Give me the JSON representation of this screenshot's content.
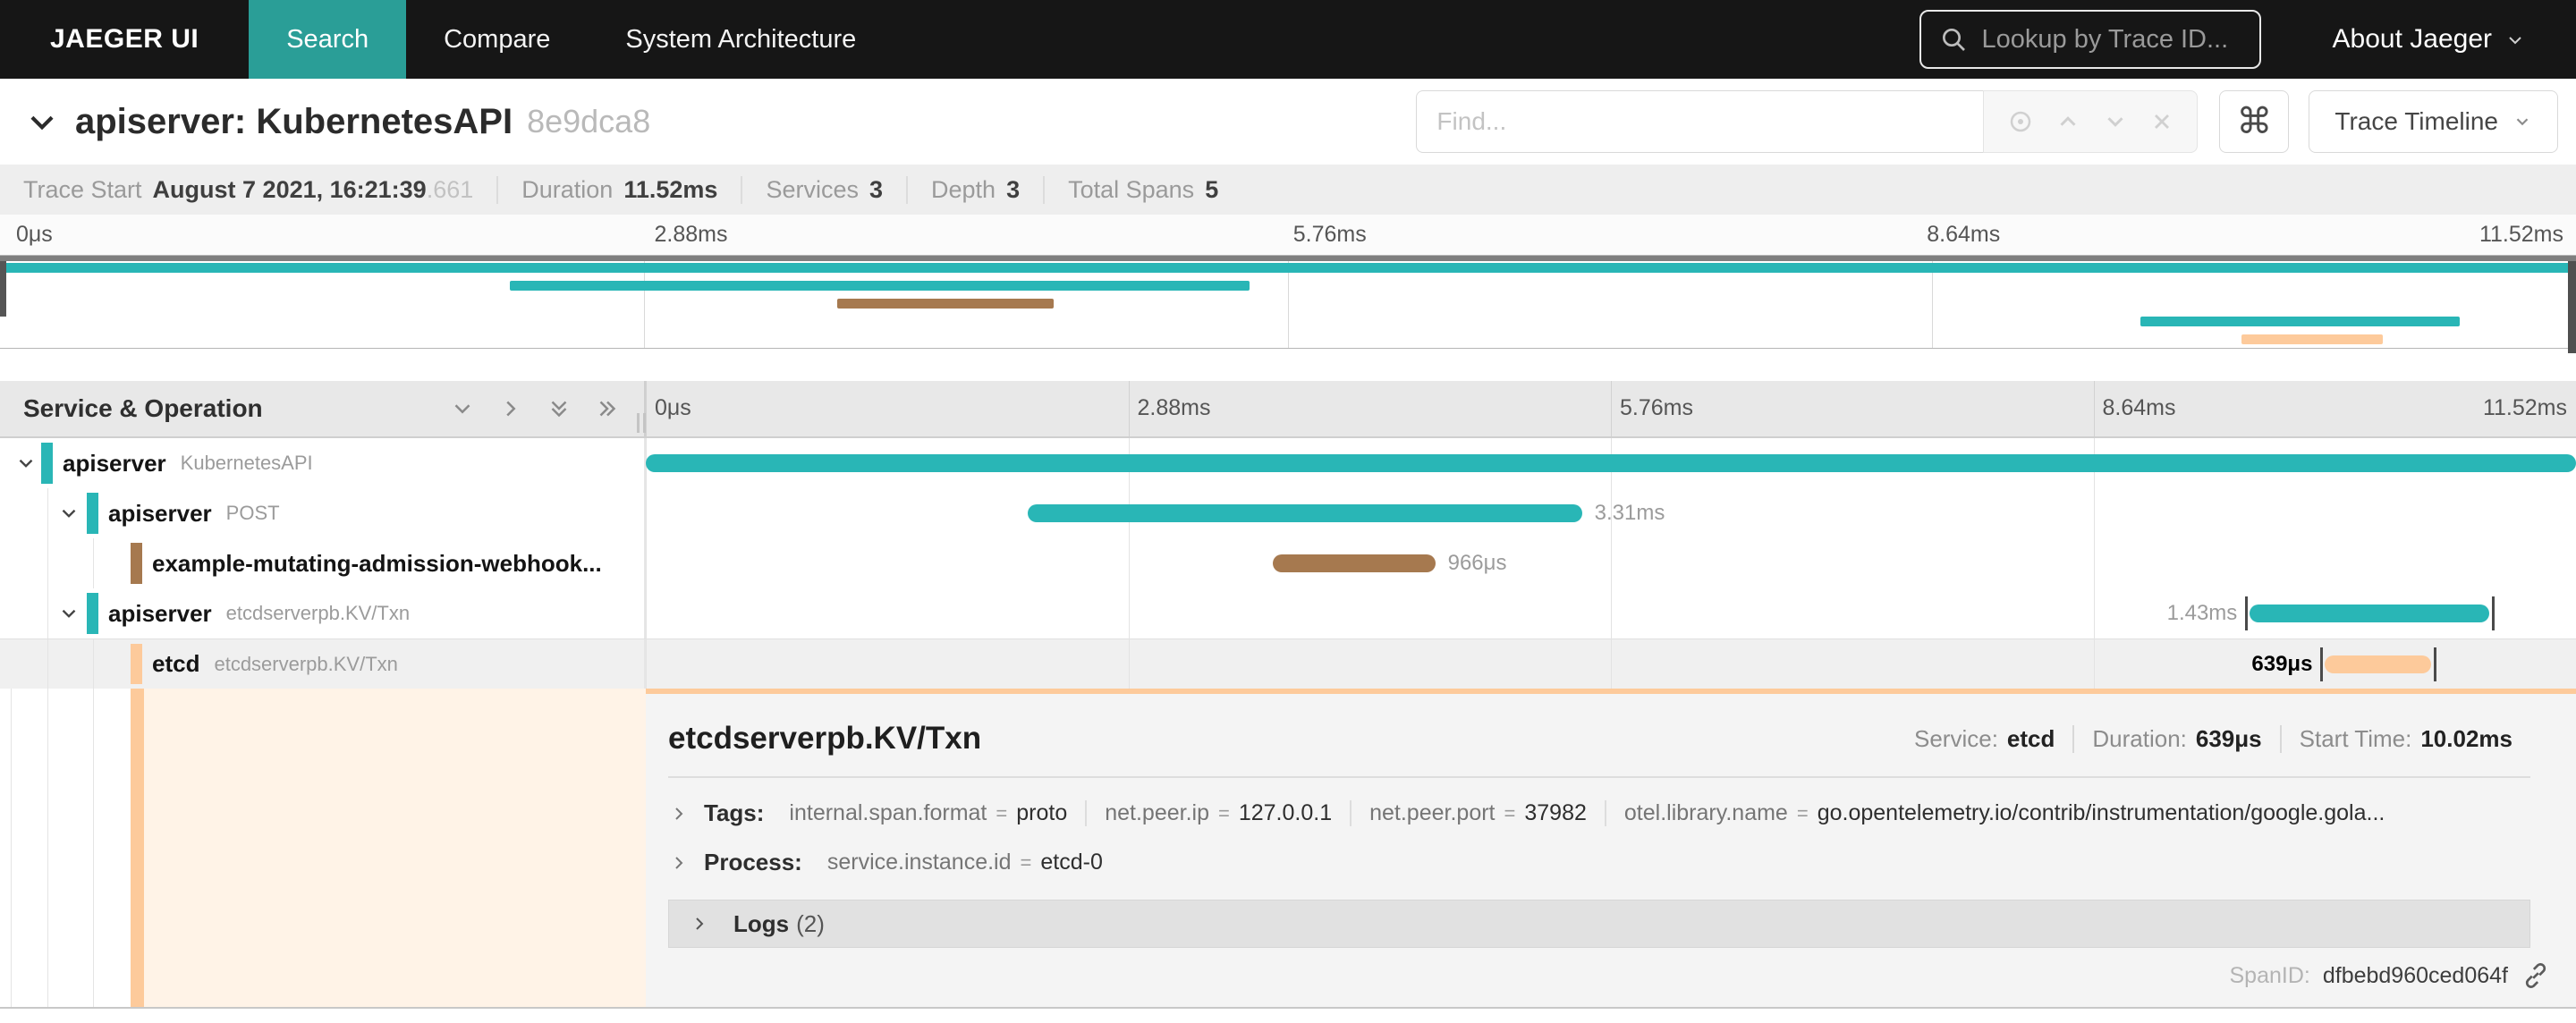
{
  "colors": {
    "teal": "#29b6b6",
    "brown": "#a6794f",
    "peach": "#fdca9b",
    "peach_light": "#fff3e7",
    "nav_active": "#2a9e97"
  },
  "nav": {
    "brand": "JAEGER UI",
    "search": "Search",
    "compare": "Compare",
    "system_architecture": "System Architecture",
    "lookup_placeholder": "Lookup by Trace ID...",
    "about": "About Jaeger"
  },
  "header": {
    "title": "apiserver: KubernetesAPI",
    "trace_id": "8e9dca8",
    "find_placeholder": "Find...",
    "view_selector": "Trace Timeline"
  },
  "stats": {
    "trace_start_label": "Trace Start",
    "trace_start_value": "August 7 2021, 16:21:39",
    "trace_start_suffix": ".661",
    "duration_label": "Duration",
    "duration_value": "11.52ms",
    "services_label": "Services",
    "services_value": "3",
    "depth_label": "Depth",
    "depth_value": "3",
    "total_spans_label": "Total Spans",
    "total_spans_value": "5"
  },
  "timeline": {
    "left_header": "Service & Operation",
    "ticks": [
      "0μs",
      "2.88ms",
      "5.76ms",
      "8.64ms",
      "11.52ms"
    ],
    "spans": [
      {
        "service": "apiserver",
        "operation": "KubernetesAPI",
        "left": "0%",
        "width": "100%",
        "color": "#29b6b6",
        "duration_label": ""
      },
      {
        "service": "apiserver",
        "operation": "POST",
        "left": "19.8%",
        "width": "28.7%",
        "color": "#29b6b6",
        "duration_label": "3.31ms"
      },
      {
        "service": "example-mutating-admission-webhook...",
        "operation": "",
        "left": "32.5%",
        "width": "8.4%",
        "color": "#a6794f",
        "duration_label": "966μs"
      },
      {
        "service": "apiserver",
        "operation": "etcdserverpb.KV/Txn",
        "left": "83.1%",
        "width": "12.4%",
        "color": "#29b6b6",
        "duration_label": "1.43ms"
      },
      {
        "service": "etcd",
        "operation": "etcdserverpb.KV/Txn",
        "left": "87%",
        "width": "5.5%",
        "color": "#fdca9b",
        "duration_label": "639μs"
      }
    ]
  },
  "detail": {
    "operation": "etcdserverpb.KV/Txn",
    "service_label": "Service:",
    "service": "etcd",
    "duration_label": "Duration:",
    "duration": "639μs",
    "start_time_label": "Start Time:",
    "start_time": "10.02ms",
    "eq": "=",
    "tags_label": "Tags:",
    "tags": [
      {
        "key": "internal.span.format",
        "value": "proto"
      },
      {
        "key": "net.peer.ip",
        "value": "127.0.0.1"
      },
      {
        "key": "net.peer.port",
        "value": "37982"
      },
      {
        "key": "otel.library.name",
        "value": "go.opentelemetry.io/contrib/instrumentation/google.gola..."
      }
    ],
    "process_label": "Process:",
    "process": [
      {
        "key": "service.instance.id",
        "value": "etcd-0"
      }
    ],
    "logs_label": "Logs",
    "logs_count": "(2)",
    "spanid_label": "SpanID:",
    "spanid": "dfbebd960ced064f"
  }
}
